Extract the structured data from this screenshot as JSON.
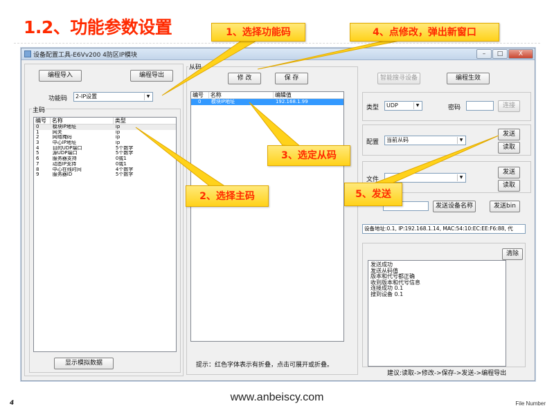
{
  "slide": {
    "title": "1.2、功能参数设置",
    "page_number": "4",
    "url": "www.anbeiscy.com",
    "file_number": "File Number"
  },
  "window": {
    "title": "设备配置工具-E6Vv200 4防区IP模块",
    "controls": {
      "minimize": "–",
      "maximize": "□",
      "close": "X"
    }
  },
  "left_panel": {
    "import_button": "编程导入",
    "export_button": "编程导出",
    "function_code_label": "功能码",
    "function_code_value": "2-IP设置",
    "master_group_label": "主码",
    "columns": [
      "编号",
      "名称",
      "类型"
    ],
    "rows": [
      {
        "id": "0",
        "name": "模块IP地址",
        "type": "ip"
      },
      {
        "id": "1",
        "name": "网关",
        "type": "ip"
      },
      {
        "id": "2",
        "name": "网络掩码",
        "type": "ip"
      },
      {
        "id": "3",
        "name": "中心IP地址",
        "type": "ip"
      },
      {
        "id": "4",
        "name": "目的UDP端口",
        "type": "5个数字"
      },
      {
        "id": "5",
        "name": "源UDP端口",
        "type": "5个数字"
      },
      {
        "id": "6",
        "name": "服务器支持",
        "type": "0或1"
      },
      {
        "id": "7",
        "name": "动态IP支持",
        "type": "0或1"
      },
      {
        "id": "8",
        "name": "中心在线时间",
        "type": "4个数字"
      },
      {
        "id": "9",
        "name": "服务器ID",
        "type": "5个数字"
      }
    ],
    "simulate_button": "显示模拟数据"
  },
  "middle_panel": {
    "group_label": "从码",
    "modify_button": "修 改",
    "save_button": "保 存",
    "columns": [
      "编号",
      "名称",
      "编辑值"
    ],
    "rows": [
      {
        "id": "0",
        "name": "模块IP地址",
        "value": "192.168.1.99"
      }
    ],
    "hint": "提示：红色字体表示有折叠，点击可展开或折叠。"
  },
  "right_panel": {
    "smart_search_button": "智能搜寻设备",
    "program_effective_button": "编程生效",
    "type_label": "类型",
    "type_value": "UDP",
    "password_label": "密码",
    "password_value": "",
    "connect_button": "连接",
    "config_label": "配置",
    "config_value": "当前从码",
    "config_send_button": "发送",
    "config_read_button": "读取",
    "file_label": "文件",
    "file_value": "",
    "file_send_button": "发送",
    "file_read_button": "读取",
    "device_name_value": "",
    "send_device_name_button": "发送设备名称",
    "send_bin_button": "发送bin",
    "device_info": "设备地址:0.1, IP:192.168.1.14, MAC:54:10:EC:EE:F6:88, 代",
    "clear_button": "清除",
    "log_lines": [
      "发送成功",
      "发送从码值",
      "版本和代号都正确",
      "收到版本和代号信息",
      "连接成功 0.1",
      "搜到设备 0.1"
    ],
    "suggestion": "建议:读取->修改->保存->发送->编程导出"
  },
  "callouts": [
    {
      "label": "1、选择功能码"
    },
    {
      "label": "2、选择主码"
    },
    {
      "label": "3、选定从码"
    },
    {
      "label": "4、点修改，弹出新窗口"
    },
    {
      "label": "5、发送"
    }
  ],
  "colors": {
    "title_red": "#ff2a00",
    "callout_yellow": "#ffd21a",
    "selection_blue": "#3399ff"
  }
}
